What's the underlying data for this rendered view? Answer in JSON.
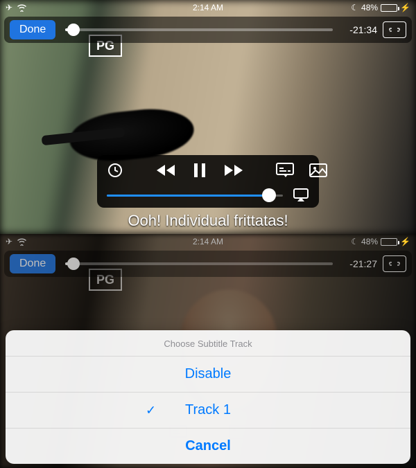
{
  "top": {
    "status": {
      "time": "2:14 AM",
      "battery_pct": "48%",
      "battery_fill": 48
    },
    "player": {
      "done_label": "Done",
      "time_remaining": "-21:34",
      "scrubber_pct": 3,
      "rating_label": "PG"
    },
    "controls": {
      "volume_pct": 92
    },
    "caption_text": "Ooh! Individual frittatas!"
  },
  "bottom": {
    "status": {
      "time": "2:14 AM",
      "battery_pct": "48%",
      "battery_fill": 48
    },
    "player": {
      "done_label": "Done",
      "time_remaining": "-21:27",
      "scrubber_pct": 3,
      "rating_label": "PG"
    },
    "sheet": {
      "title": "Choose Subtitle Track",
      "option_disable": "Disable",
      "option_track1": "Track 1",
      "cancel": "Cancel",
      "selected_index": 1
    }
  }
}
